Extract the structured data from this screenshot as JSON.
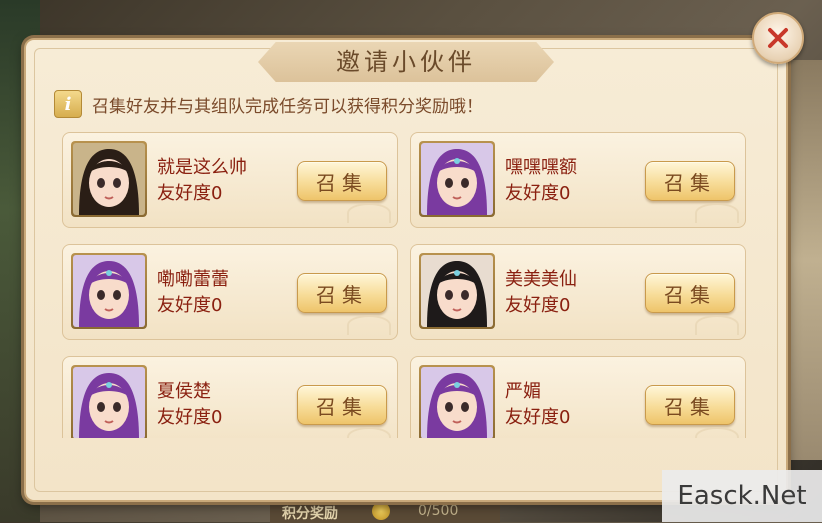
{
  "dialog": {
    "title": "邀请小伙伴",
    "info": "召集好友并与其组队完成任务可以获得积分奖励哦！",
    "info_icon": "i",
    "close": "✕"
  },
  "friends": [
    {
      "name": "就是这么帅",
      "friendship": "友好度0",
      "button": "召集",
      "avatar": "male"
    },
    {
      "name": "嘿嘿嘿额",
      "friendship": "友好度0",
      "button": "召集",
      "avatar": "purple"
    },
    {
      "name": "嘞嘞蕾蕾",
      "friendship": "友好度0",
      "button": "召集",
      "avatar": "purple"
    },
    {
      "name": "美美美仙",
      "friendship": "友好度0",
      "button": "召集",
      "avatar": "dark"
    },
    {
      "name": "夏侯楚",
      "friendship": "友好度0",
      "button": "召集",
      "avatar": "purple"
    },
    {
      "name": "严媚",
      "friendship": "友好度0",
      "button": "召集",
      "avatar": "purple"
    }
  ],
  "bottom_bar": {
    "label": "积分奖励",
    "value": "0/500"
  },
  "watermark": "Easck.Net",
  "colors": {
    "accent": "#8a2010",
    "panel": "#f3e4c8",
    "button": "#f7dc98"
  }
}
